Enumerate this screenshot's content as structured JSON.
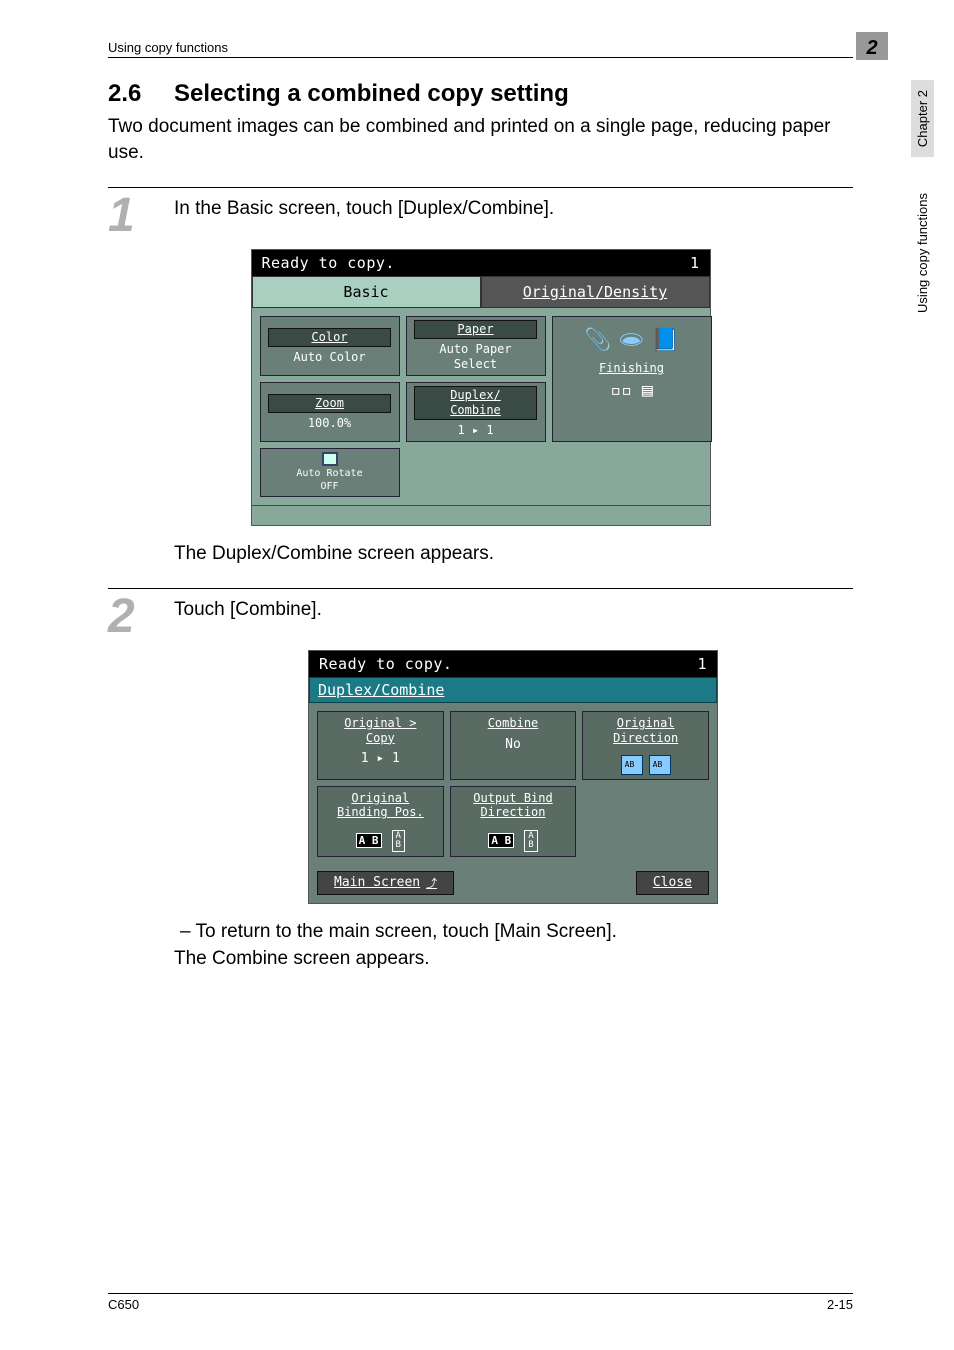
{
  "header": {
    "section_name": "Using copy functions",
    "chapter_num": "2"
  },
  "side": {
    "chapter": "Chapter 2",
    "section": "Using copy functions"
  },
  "title": {
    "num": "2.6",
    "text": "Selecting a combined copy setting"
  },
  "intro": "Two document images can be combined and printed on a single page, reducing paper use.",
  "step1": {
    "num": "1",
    "text": "In the Basic screen, touch [Duplex/Combine].",
    "after": "The Duplex/Combine screen appears."
  },
  "screen1": {
    "status": "Ready to copy.",
    "counter": "1",
    "tabs": {
      "basic": "Basic",
      "orig_density": "Original/Density"
    },
    "color": {
      "label": "Color",
      "value": "Auto Color"
    },
    "paper": {
      "label": "Paper",
      "value": "Auto Paper\nSelect"
    },
    "finishing": {
      "label": "Finishing"
    },
    "zoom": {
      "label": "Zoom",
      "value": "100.0%"
    },
    "duplex": {
      "label": "Duplex/\nCombine",
      "value": "1 ▸ 1"
    },
    "autorotate": {
      "label": "Auto Rotate\nOFF"
    }
  },
  "step2": {
    "num": "2",
    "text": "Touch [Combine].",
    "sub": "–  To return to the main screen, touch [Main Screen].",
    "after": "The Combine screen appears."
  },
  "screen2": {
    "status": "Ready to copy.",
    "counter": "1",
    "title": "Duplex/Combine",
    "orig_copy": {
      "label": "Original >\nCopy",
      "value": "1 ▸ 1"
    },
    "combine": {
      "label": "Combine",
      "value": "No"
    },
    "orig_dir": {
      "label": "Original\nDirection"
    },
    "orig_bind": {
      "label": "Original\nBinding Pos."
    },
    "out_bind": {
      "label": "Output Bind\nDirection"
    },
    "main_screen": "Main Screen",
    "close": "Close"
  },
  "footer": {
    "model": "C650",
    "page": "2-15"
  }
}
